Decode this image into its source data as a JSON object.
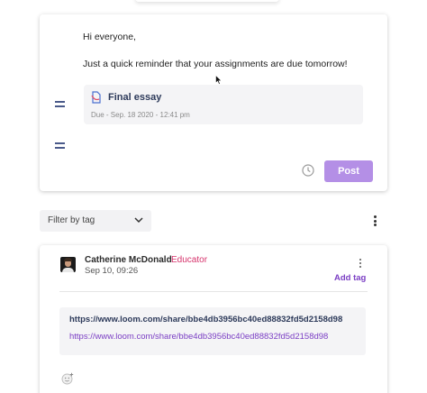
{
  "composer": {
    "greeting": "Hi everyone,",
    "message": "Just a quick reminder that your assignments are due tomorrow!",
    "attachment": {
      "title": "Final essay",
      "due": "Due - Sep. 18 2020 - 12:41 pm"
    },
    "post_label": "Post"
  },
  "filter": {
    "label": "Filter by tag"
  },
  "post": {
    "author": "Catherine McDonald",
    "role": "Educator",
    "date": "Sep 10, 09:26",
    "add_tag_label": "Add tag",
    "link_bold": "https://www.loom.com/share/bbe4db3956bc40ed88832fd5d2158d98",
    "link_url": "https://www.loom.com/share/bbe4db3956bc40ed88832fd5d2158d98"
  },
  "colors": {
    "accent": "#7b3fc4",
    "post_button": "#b48fe6",
    "educator_badge": "#d6336c"
  },
  "icons": [
    "drag-handle-icon",
    "document-icon",
    "clock-icon",
    "chevron-down-icon",
    "kebab-menu-icon",
    "add-reaction-icon",
    "cursor-icon"
  ]
}
